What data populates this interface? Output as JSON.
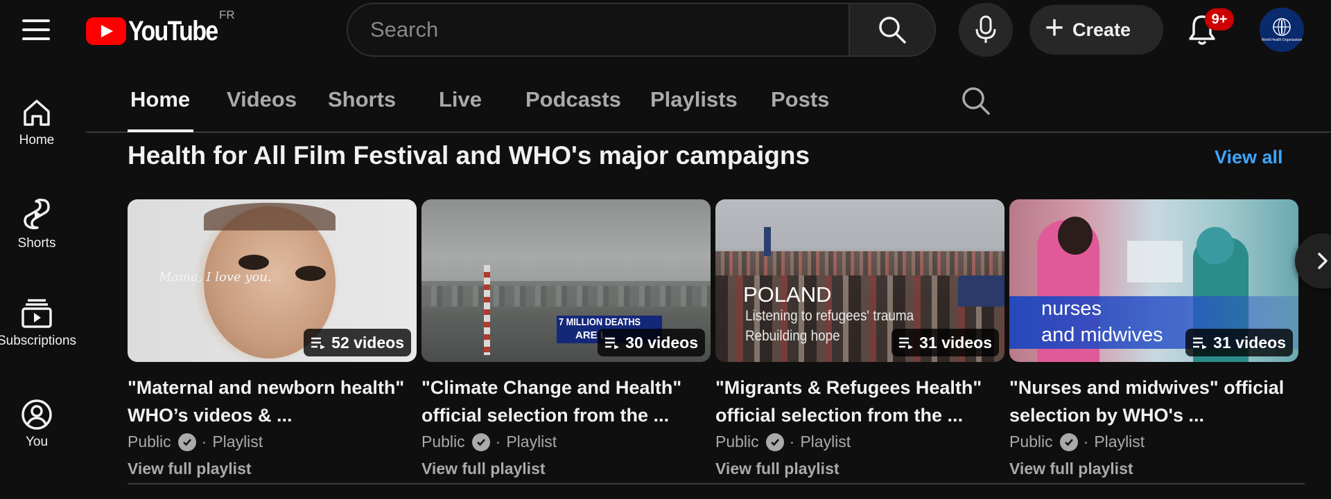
{
  "header": {
    "logo_text": "YouTube",
    "country_code": "FR",
    "search_placeholder": "Search",
    "create_label": "Create",
    "notification_badge": "9+",
    "avatar_text": "World Health Organization"
  },
  "sidebar": {
    "items": [
      {
        "label": "Home",
        "icon": "home-icon"
      },
      {
        "label": "Shorts",
        "icon": "shorts-icon"
      },
      {
        "label": "Subscriptions",
        "icon": "subscriptions-icon"
      },
      {
        "label": "You",
        "icon": "account-icon"
      }
    ]
  },
  "tabs": [
    {
      "label": "Home",
      "active": true
    },
    {
      "label": "Videos"
    },
    {
      "label": "Shorts"
    },
    {
      "label": "Live"
    },
    {
      "label": "Podcasts"
    },
    {
      "label": "Playlists"
    },
    {
      "label": "Posts"
    }
  ],
  "shelf": {
    "title": "Health for All Film Festival and WHO's major campaigns",
    "view_all": "View all",
    "cards": [
      {
        "title": "\"Maternal and newborn health\" WHO’s videos & ...",
        "count": "52 videos",
        "visibility": "Public",
        "type": "Playlist",
        "link": "View full playlist",
        "overlay": "Mama, I love you."
      },
      {
        "title": "\"Climate Change and Health\" official selection from the ...",
        "count": "30 videos",
        "visibility": "Public",
        "type": "Playlist",
        "link": "View full playlist",
        "overlay_line1": "7 MILLION DEATHS",
        "overlay_line2": "ARE L"
      },
      {
        "title": "\"Migrants & Refugees Health\" official selection from the ...",
        "count": "31 videos",
        "visibility": "Public",
        "type": "Playlist",
        "link": "View full playlist",
        "overlay_line1": "POLAND",
        "overlay_line2": "Listening to refugees' trauma",
        "overlay_line3": "Rebuilding hope"
      },
      {
        "title": "\"Nurses and midwives\" official selection by WHO's ...",
        "count": "31 videos",
        "visibility": "Public",
        "type": "Playlist",
        "link": "View full playlist",
        "overlay_line1": "nurses",
        "overlay_line2": "and midwives"
      }
    ]
  },
  "separator": "·",
  "colors": {
    "background": "#0f0f0f",
    "accent_link": "#3ea6ff",
    "brand_red": "#ff0000",
    "badge_red": "#cc0000"
  }
}
